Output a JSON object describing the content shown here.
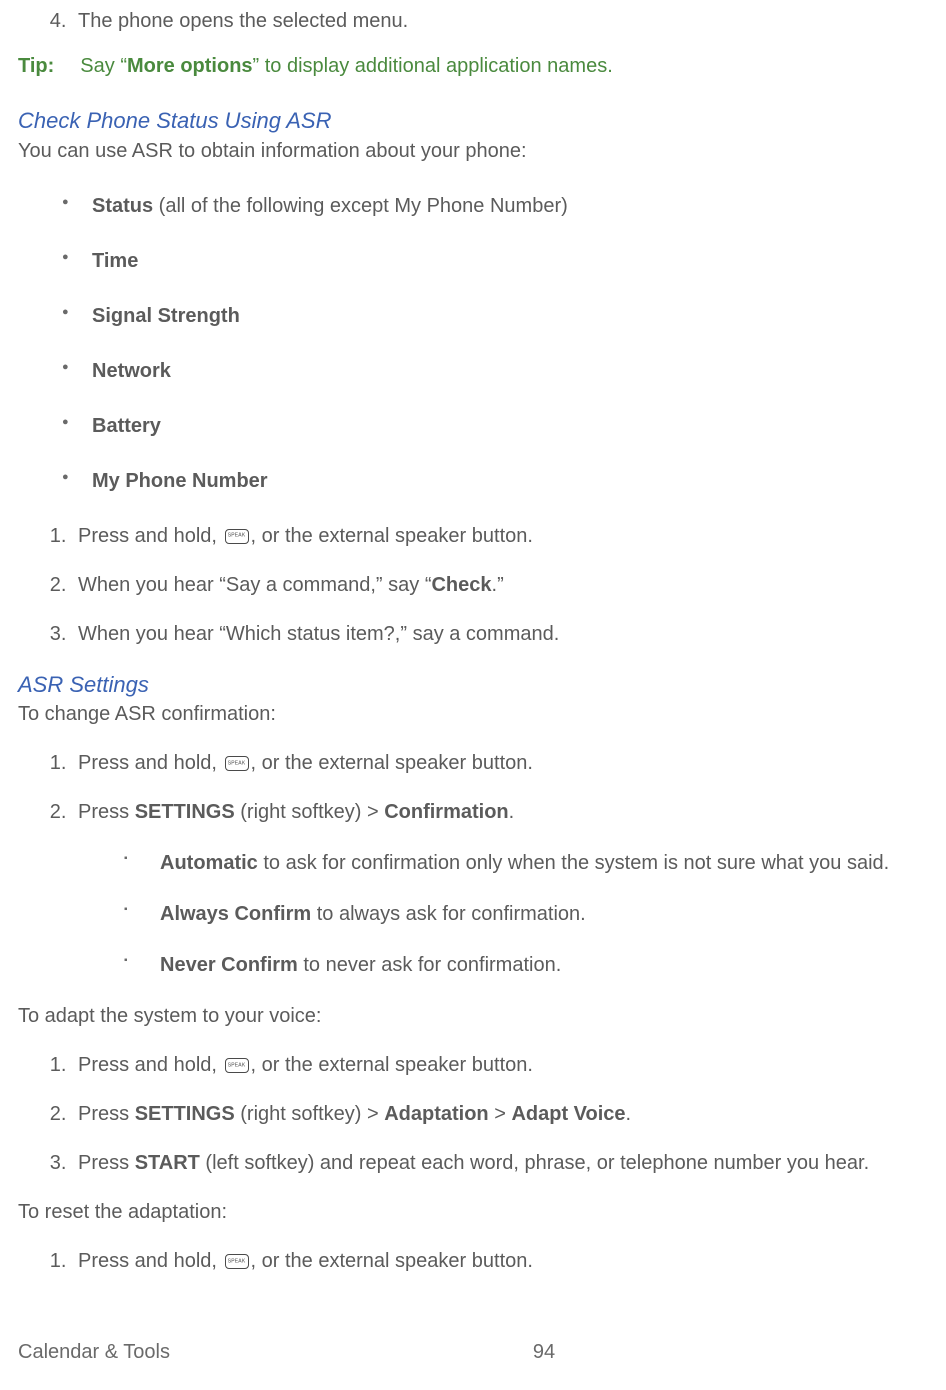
{
  "top_list": {
    "start": 4,
    "item": "The phone opens the selected menu."
  },
  "tip": {
    "label": "Tip:",
    "before": "Say “",
    "bold": "More options",
    "after": "” to display additional application names."
  },
  "check_status": {
    "heading": "Check Phone Status Using ASR",
    "intro": "You can use ASR to obtain information about your phone:",
    "bullets": [
      {
        "bold": "Status",
        "rest": " (all of the following except My Phone Number)"
      },
      {
        "bold": "Time",
        "rest": ""
      },
      {
        "bold": "Signal Strength",
        "rest": ""
      },
      {
        "bold": "Network",
        "rest": ""
      },
      {
        "bold": "Battery",
        "rest": ""
      },
      {
        "bold": "My Phone Number",
        "rest": ""
      }
    ],
    "steps": {
      "s1_before": "Press and hold, ",
      "s1_after": ", or the external speaker button.",
      "s2_before": "When you hear “Say a command,” say “",
      "s2_bold": "Check",
      "s2_after": ".”",
      "s3": "When you hear “Which status item?,” say a command."
    }
  },
  "asr_settings": {
    "heading": "ASR Settings",
    "confirm_intro": "To change ASR confirmation:",
    "confirm_steps": {
      "s1_before": "Press and hold, ",
      "s1_after": ", or the external speaker button.",
      "s2_a": "Press ",
      "s2_b": "SETTINGS",
      "s2_c": " (right softkey) > ",
      "s2_d": "Confirmation",
      "s2_e": ".",
      "sub": [
        {
          "bold": "Automatic",
          "rest": " to ask for confirmation only when the system is not sure what you said."
        },
        {
          "bold": "Always Confirm",
          "rest": " to always ask for confirmation."
        },
        {
          "bold": "Never Confirm",
          "rest": " to never ask for confirmation."
        }
      ]
    },
    "adapt_intro": "To adapt the system to your voice:",
    "adapt_steps": {
      "s1_before": "Press and hold, ",
      "s1_after": ", or the external speaker button.",
      "s2_a": "Press ",
      "s2_b": "SETTINGS",
      "s2_c": " (right softkey) > ",
      "s2_d": "Adaptation",
      "s2_e": " > ",
      "s2_f": "Adapt Voice",
      "s2_g": ".",
      "s3_a": "Press ",
      "s3_b": "START",
      "s3_c": " (left softkey) and repeat each word, phrase, or telephone number you hear."
    },
    "reset_intro": "To reset the adaptation:",
    "reset_steps": {
      "s1_before": "Press and hold, ",
      "s1_after": ", or the external speaker button."
    }
  },
  "footer": {
    "section": "Calendar & Tools",
    "page": "94"
  }
}
